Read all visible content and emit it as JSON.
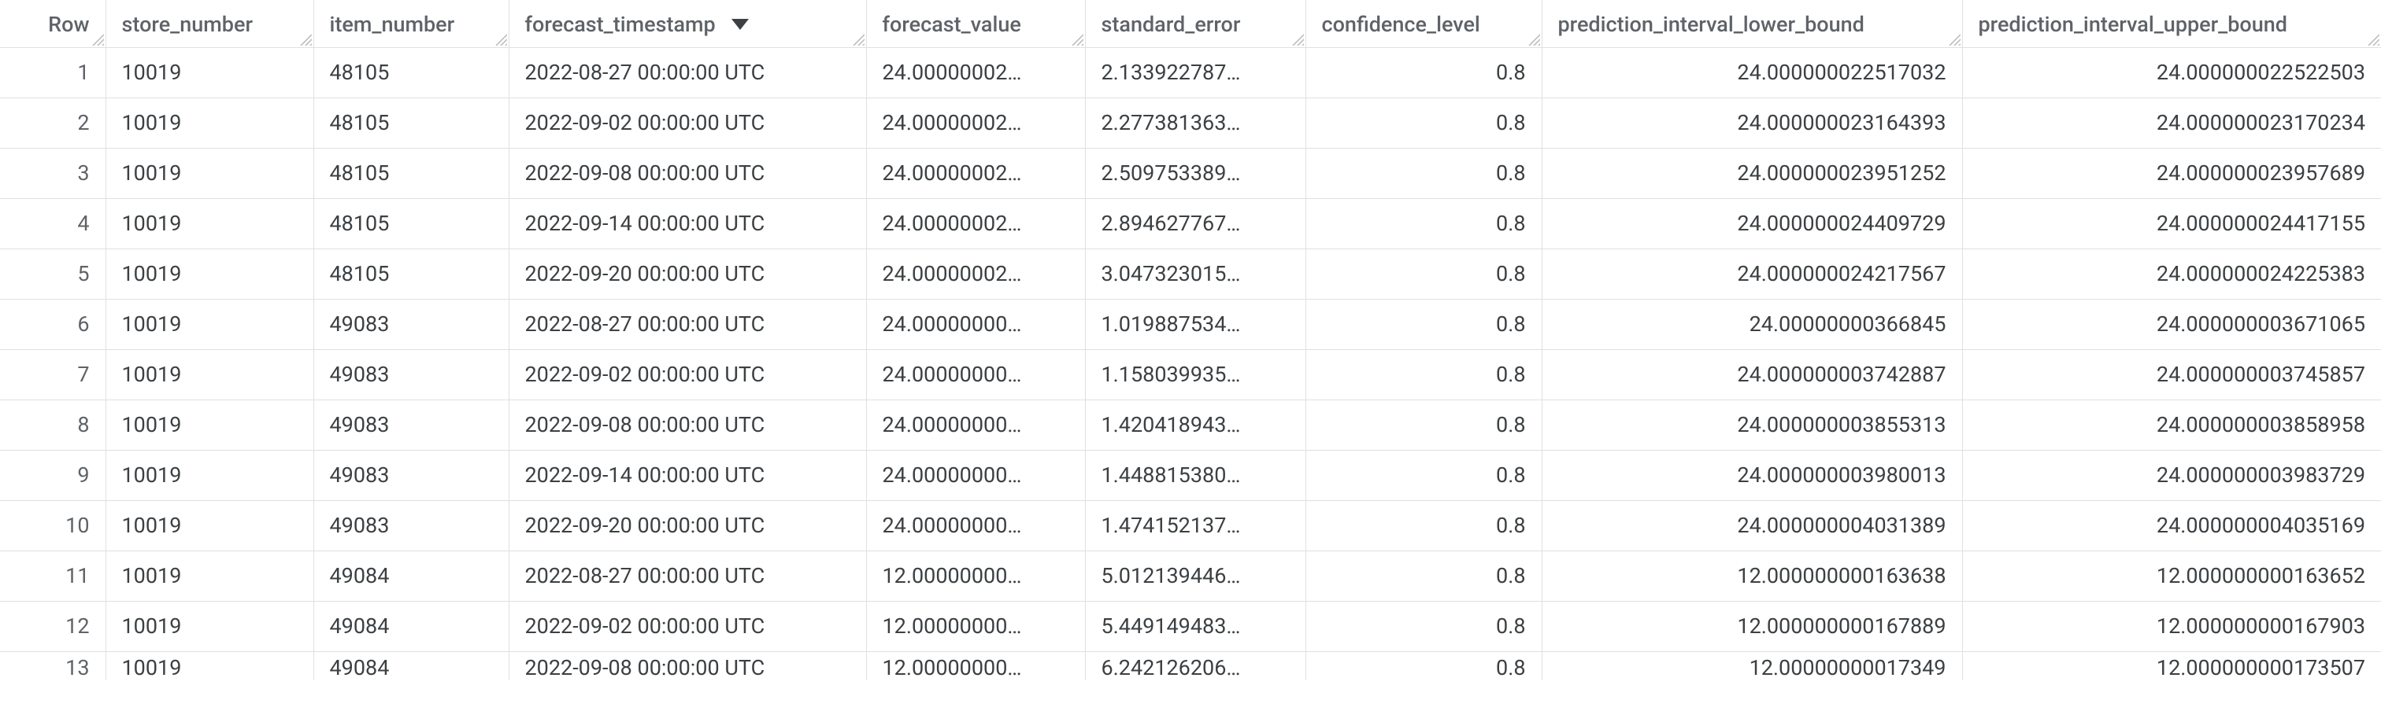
{
  "columns": {
    "row": "Row",
    "store_number": "store_number",
    "item_number": "item_number",
    "forecast_timestamp": "forecast_timestamp",
    "forecast_value": "forecast_value",
    "standard_error": "standard_error",
    "confidence_level": "confidence_level",
    "prediction_interval_lower_bound": "prediction_interval_lower_bound",
    "prediction_interval_upper_bound": "prediction_interval_upper_bound"
  },
  "rows": [
    {
      "row": "1",
      "store_number": "10019",
      "item_number": "48105",
      "forecast_timestamp": "2022-08-27 00:00:00 UTC",
      "forecast_value": "24.00000002…",
      "standard_error": "2.133922787…",
      "confidence_level": "0.8",
      "lower": "24.000000022517032",
      "upper": "24.000000022522503"
    },
    {
      "row": "2",
      "store_number": "10019",
      "item_number": "48105",
      "forecast_timestamp": "2022-09-02 00:00:00 UTC",
      "forecast_value": "24.00000002…",
      "standard_error": "2.277381363…",
      "confidence_level": "0.8",
      "lower": "24.000000023164393",
      "upper": "24.000000023170234"
    },
    {
      "row": "3",
      "store_number": "10019",
      "item_number": "48105",
      "forecast_timestamp": "2022-09-08 00:00:00 UTC",
      "forecast_value": "24.00000002…",
      "standard_error": "2.509753389…",
      "confidence_level": "0.8",
      "lower": "24.000000023951252",
      "upper": "24.000000023957689"
    },
    {
      "row": "4",
      "store_number": "10019",
      "item_number": "48105",
      "forecast_timestamp": "2022-09-14 00:00:00 UTC",
      "forecast_value": "24.00000002…",
      "standard_error": "2.894627767…",
      "confidence_level": "0.8",
      "lower": "24.000000024409729",
      "upper": "24.000000024417155"
    },
    {
      "row": "5",
      "store_number": "10019",
      "item_number": "48105",
      "forecast_timestamp": "2022-09-20 00:00:00 UTC",
      "forecast_value": "24.00000002…",
      "standard_error": "3.047323015…",
      "confidence_level": "0.8",
      "lower": "24.000000024217567",
      "upper": "24.000000024225383"
    },
    {
      "row": "6",
      "store_number": "10019",
      "item_number": "49083",
      "forecast_timestamp": "2022-08-27 00:00:00 UTC",
      "forecast_value": "24.00000000…",
      "standard_error": "1.019887534…",
      "confidence_level": "0.8",
      "lower": "24.00000000366845",
      "upper": "24.000000003671065"
    },
    {
      "row": "7",
      "store_number": "10019",
      "item_number": "49083",
      "forecast_timestamp": "2022-09-02 00:00:00 UTC",
      "forecast_value": "24.00000000…",
      "standard_error": "1.158039935…",
      "confidence_level": "0.8",
      "lower": "24.000000003742887",
      "upper": "24.000000003745857"
    },
    {
      "row": "8",
      "store_number": "10019",
      "item_number": "49083",
      "forecast_timestamp": "2022-09-08 00:00:00 UTC",
      "forecast_value": "24.00000000…",
      "standard_error": "1.420418943…",
      "confidence_level": "0.8",
      "lower": "24.000000003855313",
      "upper": "24.000000003858958"
    },
    {
      "row": "9",
      "store_number": "10019",
      "item_number": "49083",
      "forecast_timestamp": "2022-09-14 00:00:00 UTC",
      "forecast_value": "24.00000000…",
      "standard_error": "1.448815380…",
      "confidence_level": "0.8",
      "lower": "24.000000003980013",
      "upper": "24.000000003983729"
    },
    {
      "row": "10",
      "store_number": "10019",
      "item_number": "49083",
      "forecast_timestamp": "2022-09-20 00:00:00 UTC",
      "forecast_value": "24.00000000…",
      "standard_error": "1.474152137…",
      "confidence_level": "0.8",
      "lower": "24.000000004031389",
      "upper": "24.000000004035169"
    },
    {
      "row": "11",
      "store_number": "10019",
      "item_number": "49084",
      "forecast_timestamp": "2022-08-27 00:00:00 UTC",
      "forecast_value": "12.00000000…",
      "standard_error": "5.012139446…",
      "confidence_level": "0.8",
      "lower": "12.000000000163638",
      "upper": "12.000000000163652"
    },
    {
      "row": "12",
      "store_number": "10019",
      "item_number": "49084",
      "forecast_timestamp": "2022-09-02 00:00:00 UTC",
      "forecast_value": "12.00000000…",
      "standard_error": "5.449149483…",
      "confidence_level": "0.8",
      "lower": "12.000000000167889",
      "upper": "12.000000000167903"
    },
    {
      "row": "13",
      "store_number": "10019",
      "item_number": "49084",
      "forecast_timestamp": "2022-09-08 00:00:00 UTC",
      "forecast_value": "12.00000000…",
      "standard_error": "6.242126206…",
      "confidence_level": "0.8",
      "lower": "12.00000000017349",
      "upper": "12.000000000173507"
    }
  ]
}
